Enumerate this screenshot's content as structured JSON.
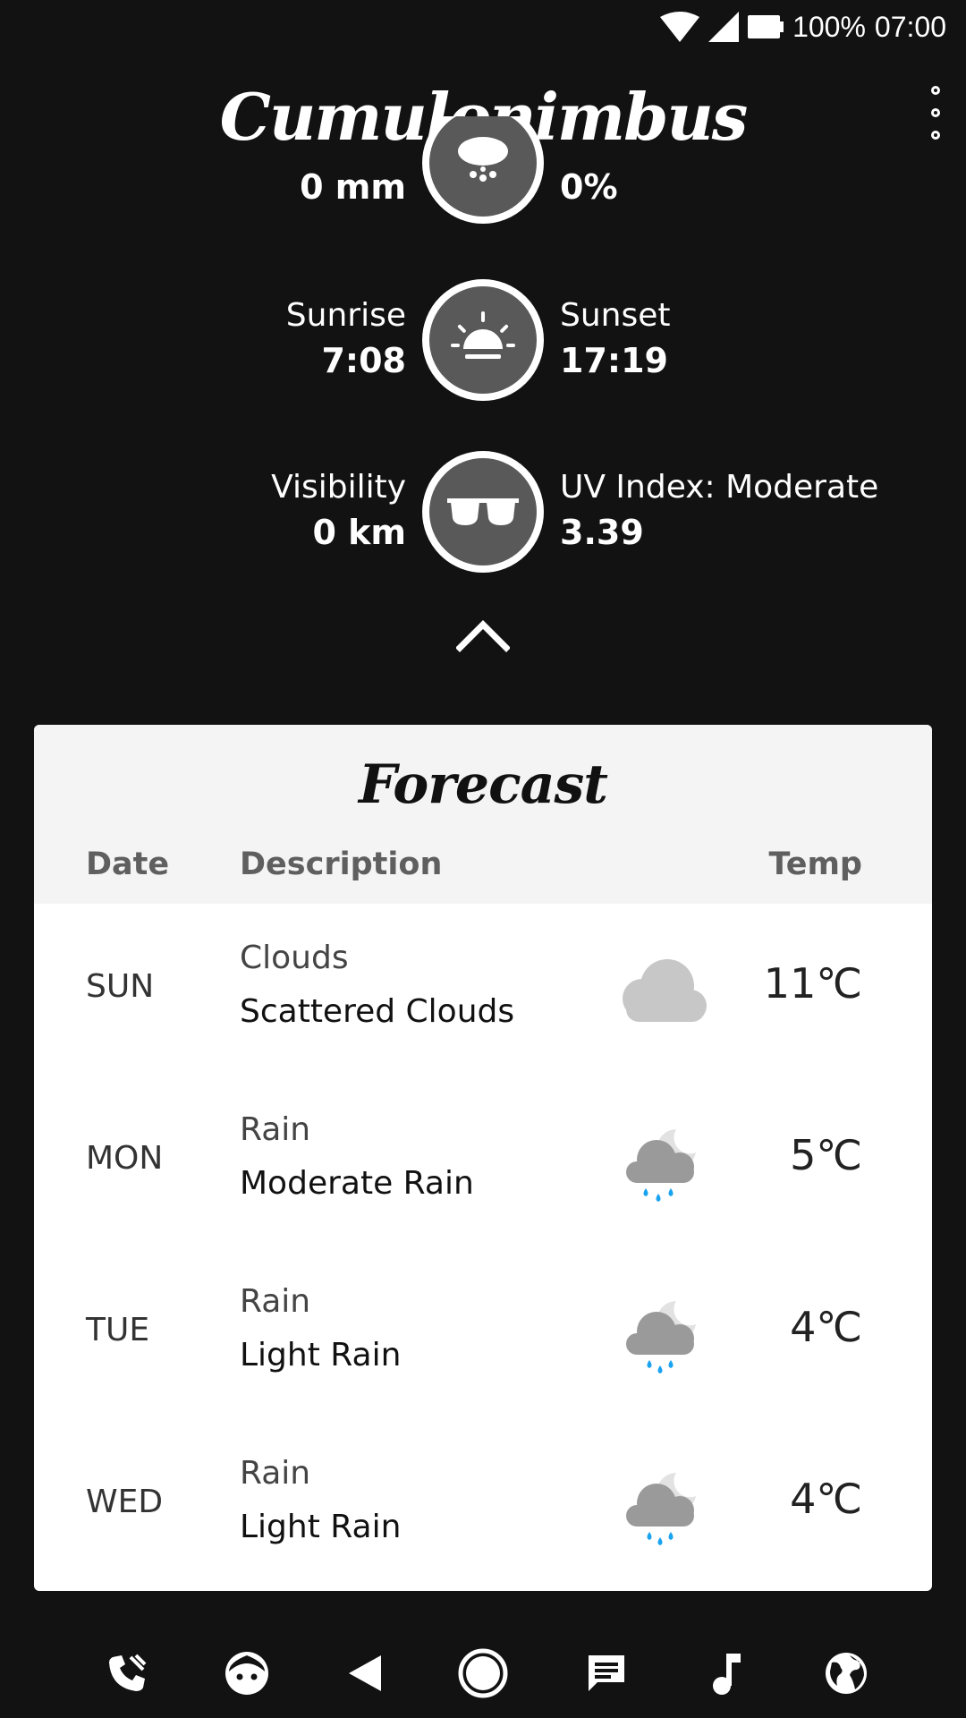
{
  "status_bar": {
    "battery": "100%",
    "time": "07:00"
  },
  "header": {
    "title": "Cumulonimbus"
  },
  "details": [
    {
      "icon": "rain-cloud-icon",
      "left_label": "",
      "left_value": "0 mm",
      "right_label": "",
      "right_value": "0%"
    },
    {
      "icon": "sunrise-icon",
      "left_label": "Sunrise",
      "left_value": "7:08",
      "right_label": "Sunset",
      "right_value": "17:19"
    },
    {
      "icon": "sunglasses-icon",
      "left_label": "Visibility",
      "left_value": "0 km",
      "right_label": "UV Index: Moderate",
      "right_value": "3.39"
    }
  ],
  "forecast": {
    "title": "Forecast",
    "columns": {
      "date": "Date",
      "description": "Description",
      "temp": "Temp"
    },
    "rows": [
      {
        "day": "SUN",
        "main": "Clouds",
        "description": "Scattered Clouds",
        "temp": "11℃",
        "icon": "cloud-icon"
      },
      {
        "day": "MON",
        "main": "Rain",
        "description": "Moderate Rain",
        "temp": "5℃",
        "icon": "rain-night-icon"
      },
      {
        "day": "TUE",
        "main": "Rain",
        "description": "Light Rain",
        "temp": "4℃",
        "icon": "rain-night-icon"
      },
      {
        "day": "WED",
        "main": "Rain",
        "description": "Light Rain",
        "temp": "4℃",
        "icon": "rain-night-icon"
      }
    ]
  },
  "colors": {
    "background": "#121212",
    "card": "#ffffff",
    "card_header": "#f4f4f4",
    "rain_drop": "#1aa3f0",
    "icon_circle": "#595959"
  },
  "bottom_nav": [
    "phone-icon",
    "face-icon",
    "back-icon",
    "home-icon",
    "message-icon",
    "music-icon",
    "globe-icon"
  ]
}
